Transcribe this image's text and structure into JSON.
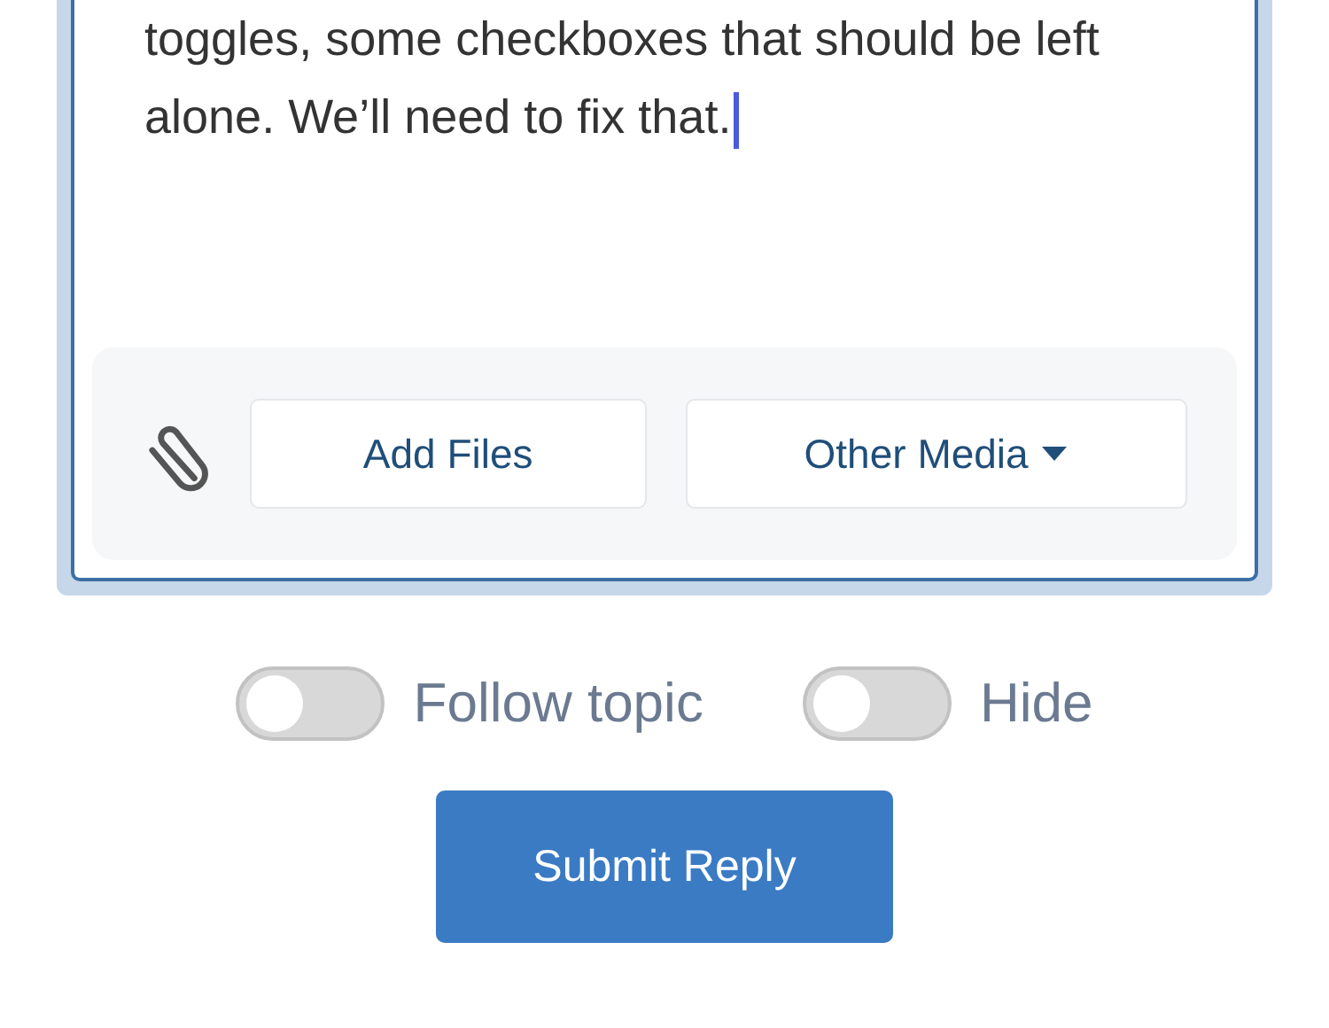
{
  "editor": {
    "value": "toggles, some checkboxes that should be left alone. We’ll need to fix that.",
    "focused": true
  },
  "toolbar": {
    "buttons": [
      {
        "label": "Add Files",
        "kind": "plain"
      },
      {
        "label": "Other Media",
        "kind": "dropdown"
      }
    ]
  },
  "toggles": [
    {
      "label": "Follow topic",
      "on": false
    },
    {
      "label": "Hide",
      "on": false
    }
  ],
  "submit": {
    "label": "Submit Reply"
  }
}
